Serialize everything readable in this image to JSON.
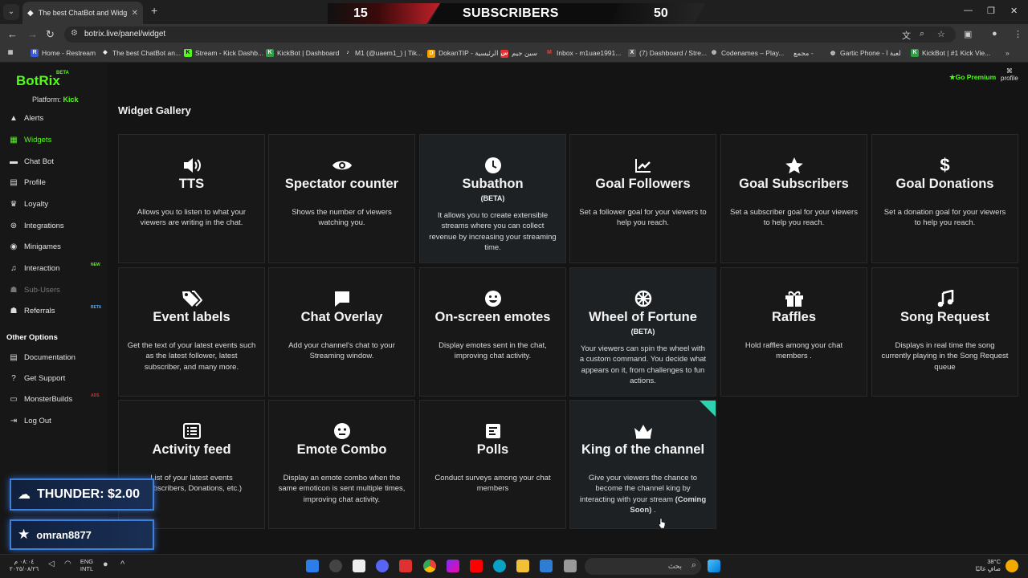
{
  "browser": {
    "tab_title": "The best ChatBot and Widgets",
    "url": "botrix.live/panel/widget",
    "bookmarks": [
      "Home - Restream",
      "The best ChatBot an...",
      "Stream - Kick Dashb...",
      "KickBot | Dashboard",
      "M1 (@uaem1_) | Tik...",
      "DokanTIP - الرئيسية",
      "سين جيم",
      "Inbox - m1uae1991...",
      "(7) Dashboard / Stre...",
      "Codenames – Play...",
      "مجمع -",
      "Gartic Phone - لعبة ا",
      "KickBot | #1 Kick Vie..."
    ]
  },
  "subscriber_bar": {
    "left_count": "15",
    "label": "SUBSCRIBERS",
    "right_count": "50"
  },
  "app": {
    "logo": "BotRix",
    "logo_badge": "BETA",
    "platform_label": "Platform:",
    "platform_value": "Kick",
    "go_premium": "Go Premium",
    "profile": "profile",
    "page_title": "Widget Gallery",
    "other_options_heading": "Other Options",
    "nav": [
      {
        "label": "Alerts",
        "icon": "warning-icon"
      },
      {
        "label": "Widgets",
        "icon": "grid-icon"
      },
      {
        "label": "Chat Bot",
        "icon": "chat-icon"
      },
      {
        "label": "Profile",
        "icon": "id-card-icon"
      },
      {
        "label": "Loyalty",
        "icon": "trophy-icon"
      },
      {
        "label": "Integrations",
        "icon": "plug-icon"
      },
      {
        "label": "Minigames",
        "icon": "gamepad-icon"
      },
      {
        "label": "Interaction",
        "icon": "music-icon",
        "badge": "NEW"
      },
      {
        "label": "Sub-Users",
        "icon": "users-icon"
      },
      {
        "label": "Referrals",
        "icon": "referral-icon",
        "badge": "BETA"
      }
    ],
    "other_nav": [
      {
        "label": "Documentation",
        "icon": "book-icon"
      },
      {
        "label": "Get Support",
        "icon": "question-icon"
      },
      {
        "label": "MonsterBuilds",
        "icon": "monitor-icon",
        "badge": "ADS"
      },
      {
        "label": "Log Out",
        "icon": "logout-icon"
      }
    ]
  },
  "widgets": [
    {
      "title": "TTS",
      "icon": "speaker-icon",
      "desc": "Allows you to listen to what your viewers are writing in the chat."
    },
    {
      "title": "Spectator counter",
      "icon": "eye-icon",
      "desc": "Shows the number of viewers watching you."
    },
    {
      "title": "Subathon",
      "icon": "clock-icon",
      "beta": "(BETA)",
      "desc": "It allows you to create extensible streams where you can collect revenue by increasing your streaming time."
    },
    {
      "title": "Goal Followers",
      "icon": "chart-line-icon",
      "desc": "Set a follower goal for your viewers to help you reach."
    },
    {
      "title": "Goal Subscribers",
      "icon": "star-icon",
      "desc": "Set a subscriber goal for your viewers to help you reach."
    },
    {
      "title": "Goal Donations",
      "icon": "dollar-icon",
      "desc": "Set a donation goal for your viewers to help you reach."
    },
    {
      "title": "Event labels",
      "icon": "tags-icon",
      "desc": "Get the text of your latest events such as the latest follower, latest subscriber, and many more."
    },
    {
      "title": "Chat Overlay",
      "icon": "message-icon",
      "desc": "Add your channel's chat to your Streaming window."
    },
    {
      "title": "On-screen emotes",
      "icon": "emoji-icon",
      "desc": "Display emotes sent in the chat, improving chat activity."
    },
    {
      "title": "Wheel of Fortune",
      "icon": "wheel-icon",
      "beta": "(BETA)",
      "desc": "Your viewers can spin the wheel with a custom command. You decide what appears on it, from challenges to fun actions."
    },
    {
      "title": "Raffles",
      "icon": "gift-icon",
      "desc": "Hold raffles among your chat members ."
    },
    {
      "title": "Song Request",
      "icon": "music-note-icon",
      "desc": "Displays in real time the song currently playing in the Song Request queue"
    },
    {
      "title": "Activity feed",
      "icon": "list-icon",
      "desc": "List of your latest events (Subscribers, Donations, etc.)"
    },
    {
      "title": "Emote Combo",
      "icon": "face-icon",
      "desc": "Display an emote combo when the same emoticon is sent multiple times, improving chat activity."
    },
    {
      "title": "Polls",
      "icon": "poll-icon",
      "desc": "Conduct surveys among your chat members"
    },
    {
      "title": "King of the channel",
      "icon": "crown-icon",
      "desc": "Give your viewers the chance to become the channel king by interacting with your stream",
      "desc_strong": "(Coming Soon)",
      "desc_tail": " ."
    }
  ],
  "overlay": {
    "donation": "THUNDER: $2.00",
    "follower": "omran8877"
  },
  "taskbar": {
    "time": "٠٨:٠٤ م",
    "date": "٢٠٢٥/٠٨/٢٦",
    "lang_top": "ENG",
    "lang_bottom": "INTL",
    "search_placeholder": "بحث",
    "weather_temp": "38°C",
    "weather_desc": "صافٍ غالبًا"
  },
  "colors": {
    "brand_green": "#53fc18",
    "card_bg": "#181818",
    "accent_teal": "#2ad4b0"
  }
}
